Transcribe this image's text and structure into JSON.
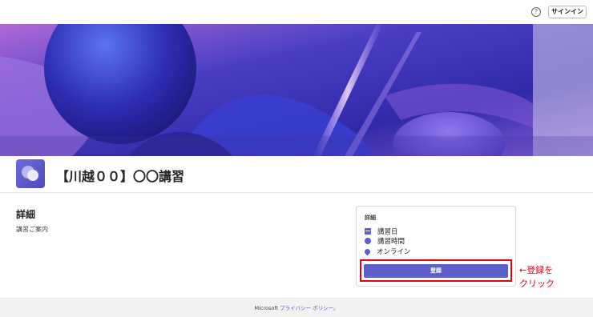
{
  "topbar": {
    "help_icon": "question-circle-icon",
    "help_glyph": "?",
    "signin_label": "サインイン"
  },
  "event": {
    "title": "【川越００】〇〇講習",
    "logo_icon": "speech-bubbles-icon"
  },
  "details": {
    "heading": "詳細",
    "description": "講習ご案内"
  },
  "card": {
    "title": "詳細",
    "date_label": "講習日",
    "time_label": "講習時間",
    "location_label": "オンライン",
    "register_label": "登録"
  },
  "annotation": {
    "line1": "←登録を",
    "line2": "クリック"
  },
  "footer": {
    "prefix": "Microsoft",
    "privacy_link": "プライバシー ポリシー。"
  },
  "colors": {
    "accent": "#5b5fc7",
    "annotation_red": "#e60012"
  }
}
